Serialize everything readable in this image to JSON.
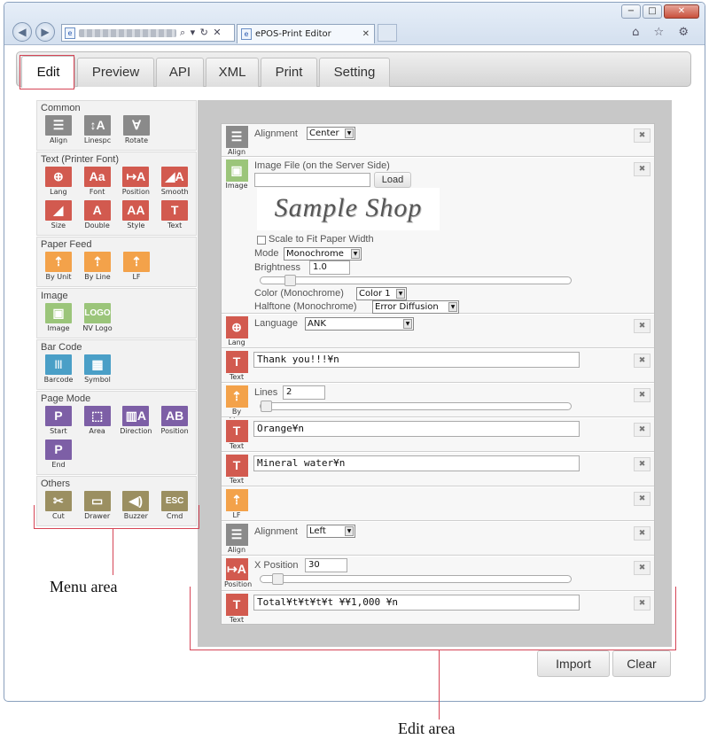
{
  "browser": {
    "address_placeholder_icon": "page-icon",
    "address_tools": "⌕ ▾ ↻ ✕",
    "tab_title": "ePOS-Print Editor",
    "window_buttons": [
      "−",
      "□",
      "✕"
    ],
    "toolbar_icons": [
      "home-icon",
      "star-icon",
      "gear-icon"
    ],
    "toolbar_glyphs": "⌂ ☆ ⚙"
  },
  "app_tabs": [
    "Edit",
    "Preview",
    "API",
    "XML",
    "Print",
    "Setting"
  ],
  "menu": {
    "sections": [
      {
        "title": "Common",
        "items": [
          {
            "label": "Align",
            "glyph": "☰",
            "color": "#8a8a8a"
          },
          {
            "label": "Linespc",
            "glyph": "↕A",
            "color": "#8a8a8a"
          },
          {
            "label": "Rotate",
            "glyph": "∀",
            "color": "#8a8a8a"
          }
        ]
      },
      {
        "title": "Text (Printer Font)",
        "items": [
          {
            "label": "Lang",
            "glyph": "⊕",
            "color": "#d25a4f"
          },
          {
            "label": "Font",
            "glyph": "Aa",
            "color": "#d25a4f"
          },
          {
            "label": "Position",
            "glyph": "↦A",
            "color": "#d25a4f"
          },
          {
            "label": "Smooth",
            "glyph": "◢A",
            "color": "#d25a4f"
          },
          {
            "label": "Size",
            "glyph": "◢",
            "color": "#d25a4f"
          },
          {
            "label": "Double",
            "glyph": "A",
            "color": "#d25a4f"
          },
          {
            "label": "Style",
            "glyph": "AA",
            "color": "#d25a4f"
          },
          {
            "label": "Text",
            "glyph": "T",
            "color": "#d25a4f"
          }
        ]
      },
      {
        "title": "Paper Feed",
        "items": [
          {
            "label": "By Unit",
            "glyph": "⇡",
            "color": "#f3a24a"
          },
          {
            "label": "By Line",
            "glyph": "⇡",
            "color": "#f3a24a"
          },
          {
            "label": "LF",
            "glyph": "⇡",
            "color": "#f3a24a"
          }
        ]
      },
      {
        "title": "Image",
        "items": [
          {
            "label": "Image",
            "glyph": "▣",
            "color": "#9bc57a"
          },
          {
            "label": "NV Logo",
            "glyph": "LOGO",
            "color": "#9bc57a"
          }
        ]
      },
      {
        "title": "Bar Code",
        "items": [
          {
            "label": "Barcode",
            "glyph": "|||",
            "color": "#4a9fc7"
          },
          {
            "label": "Symbol",
            "glyph": "▦",
            "color": "#4a9fc7"
          }
        ]
      },
      {
        "title": "Page Mode",
        "items": [
          {
            "label": "Start",
            "glyph": "P",
            "color": "#7d5fa6"
          },
          {
            "label": "Area",
            "glyph": "⬚",
            "color": "#7d5fa6"
          },
          {
            "label": "Direction",
            "glyph": "▥A",
            "color": "#7d5fa6"
          },
          {
            "label": "Position",
            "glyph": "AB",
            "color": "#7d5fa6"
          },
          {
            "label": "End",
            "glyph": "P",
            "color": "#7d5fa6"
          }
        ]
      },
      {
        "title": "Others",
        "items": [
          {
            "label": "Cut",
            "glyph": "✂",
            "color": "#9b8f61"
          },
          {
            "label": "Drawer",
            "glyph": "▭",
            "color": "#9b8f61"
          },
          {
            "label": "Buzzer",
            "glyph": "◀)",
            "color": "#9b8f61"
          },
          {
            "label": "Cmd",
            "glyph": "ESC",
            "color": "#9b8f61"
          }
        ]
      }
    ]
  },
  "edit": {
    "align1": {
      "icon_label": "Align",
      "field_label": "Alignment",
      "value": "Center"
    },
    "image": {
      "icon_label": "Image",
      "title": "Image File (on the Server Side)",
      "file_value": "",
      "load_label": "Load",
      "preview_text": "Sample Shop",
      "scale_label": "Scale to Fit Paper Width",
      "mode_label": "Mode",
      "mode_value": "Monochrome",
      "brightness_label": "Brightness",
      "brightness_value": "1.0",
      "color_label": "Color (Monochrome)",
      "color_value": "Color 1",
      "halftone_label": "Halftone (Monochrome)",
      "halftone_value": "Error Diffusion"
    },
    "lang": {
      "icon_label": "Lang",
      "field_label": "Language",
      "value": "ANK"
    },
    "text1": {
      "icon_label": "Text",
      "value": "Thank you!!!¥n"
    },
    "byline": {
      "icon_label": "By Line",
      "field_label": "Lines",
      "value": "2"
    },
    "text2": {
      "icon_label": "Text",
      "value": "Orange¥n"
    },
    "text3": {
      "icon_label": "Text",
      "value": "Mineral water¥n"
    },
    "lf": {
      "icon_label": "LF"
    },
    "align2": {
      "icon_label": "Align",
      "field_label": "Alignment",
      "value": "Left"
    },
    "position": {
      "icon_label": "Position",
      "field_label": "X Position",
      "value": "30"
    },
    "text4": {
      "icon_label": "Text",
      "value": "Total¥t¥t¥t¥t ¥¥1,000 ¥n"
    },
    "remove_glyph": "✖"
  },
  "buttons": {
    "import": "Import",
    "clear": "Clear"
  },
  "annotations": {
    "menu_area": "Menu area",
    "edit_area": "Edit area"
  },
  "colors": {
    "accent": "#d64556",
    "text_red": "#d25a4f",
    "feed_orange": "#f3a24a",
    "image_green": "#9bc57a",
    "barcode_blue": "#4a9fc7",
    "page_purple": "#7d5fa6",
    "others_olive": "#9b8f61",
    "common_gray": "#8a8a8a"
  }
}
